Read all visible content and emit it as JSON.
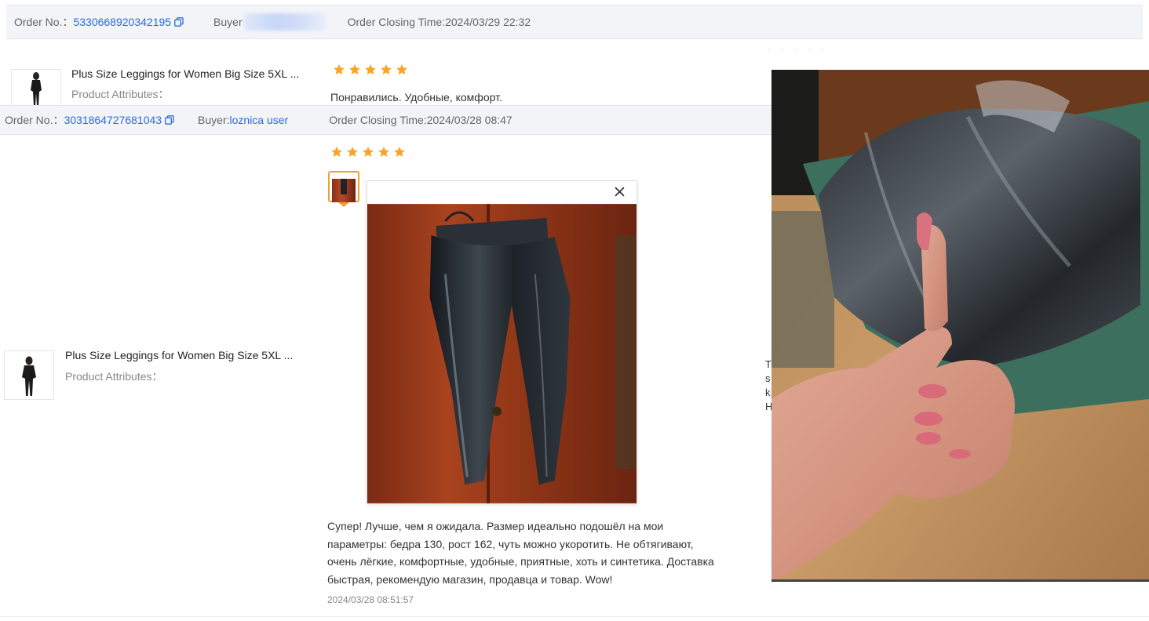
{
  "order1": {
    "order_no_label": "Order No.：",
    "order_no": "5330668920342195",
    "buyer_label": "Buyer",
    "closing_time": "Order Closing Time:2024/03/29 22:32",
    "product_name": "Plus Size Leggings for Women Big Size 5XL ...",
    "product_attributes": "Product Attributes：",
    "rating": 5,
    "review_text": "Понравились. Удобные, комфорт."
  },
  "order2": {
    "order_no_label": "Order No.：",
    "order_no": "3031864727681043",
    "buyer_label": "Buyer:",
    "buyer_name": "loznica user",
    "closing_time": "Order Closing Time:2024/03/28 08:47",
    "product_name": "Plus Size Leggings for Women Big Size 5XL ...",
    "product_attributes": "Product Attributes：",
    "rating": 5,
    "review_lines": [
      "Супер! Лучше, чем я ожидала. Размер идеально подошёл на мои",
      "параметры: бедра 130, рост 162, чуть можно укоротить. Не обтягивают,",
      "очень лёгкие, комфортные, удобные, приятные, хоть и синтетика. Доставка",
      "быстрая, рекомендую магазин, продавца и товар. Wow!"
    ],
    "review_date": "2024/03/28 08:51:57"
  },
  "right_column_partial_letters": [
    "T",
    "s",
    "k",
    "H"
  ],
  "icons": {
    "copy": "copy-icon",
    "star": "star-icon",
    "close": "close-icon"
  },
  "colors": {
    "link": "#2d6ae0",
    "star": "#f6a623",
    "header_bg": "#f2f4f7",
    "thumb_selected_border": "#f0a030"
  }
}
